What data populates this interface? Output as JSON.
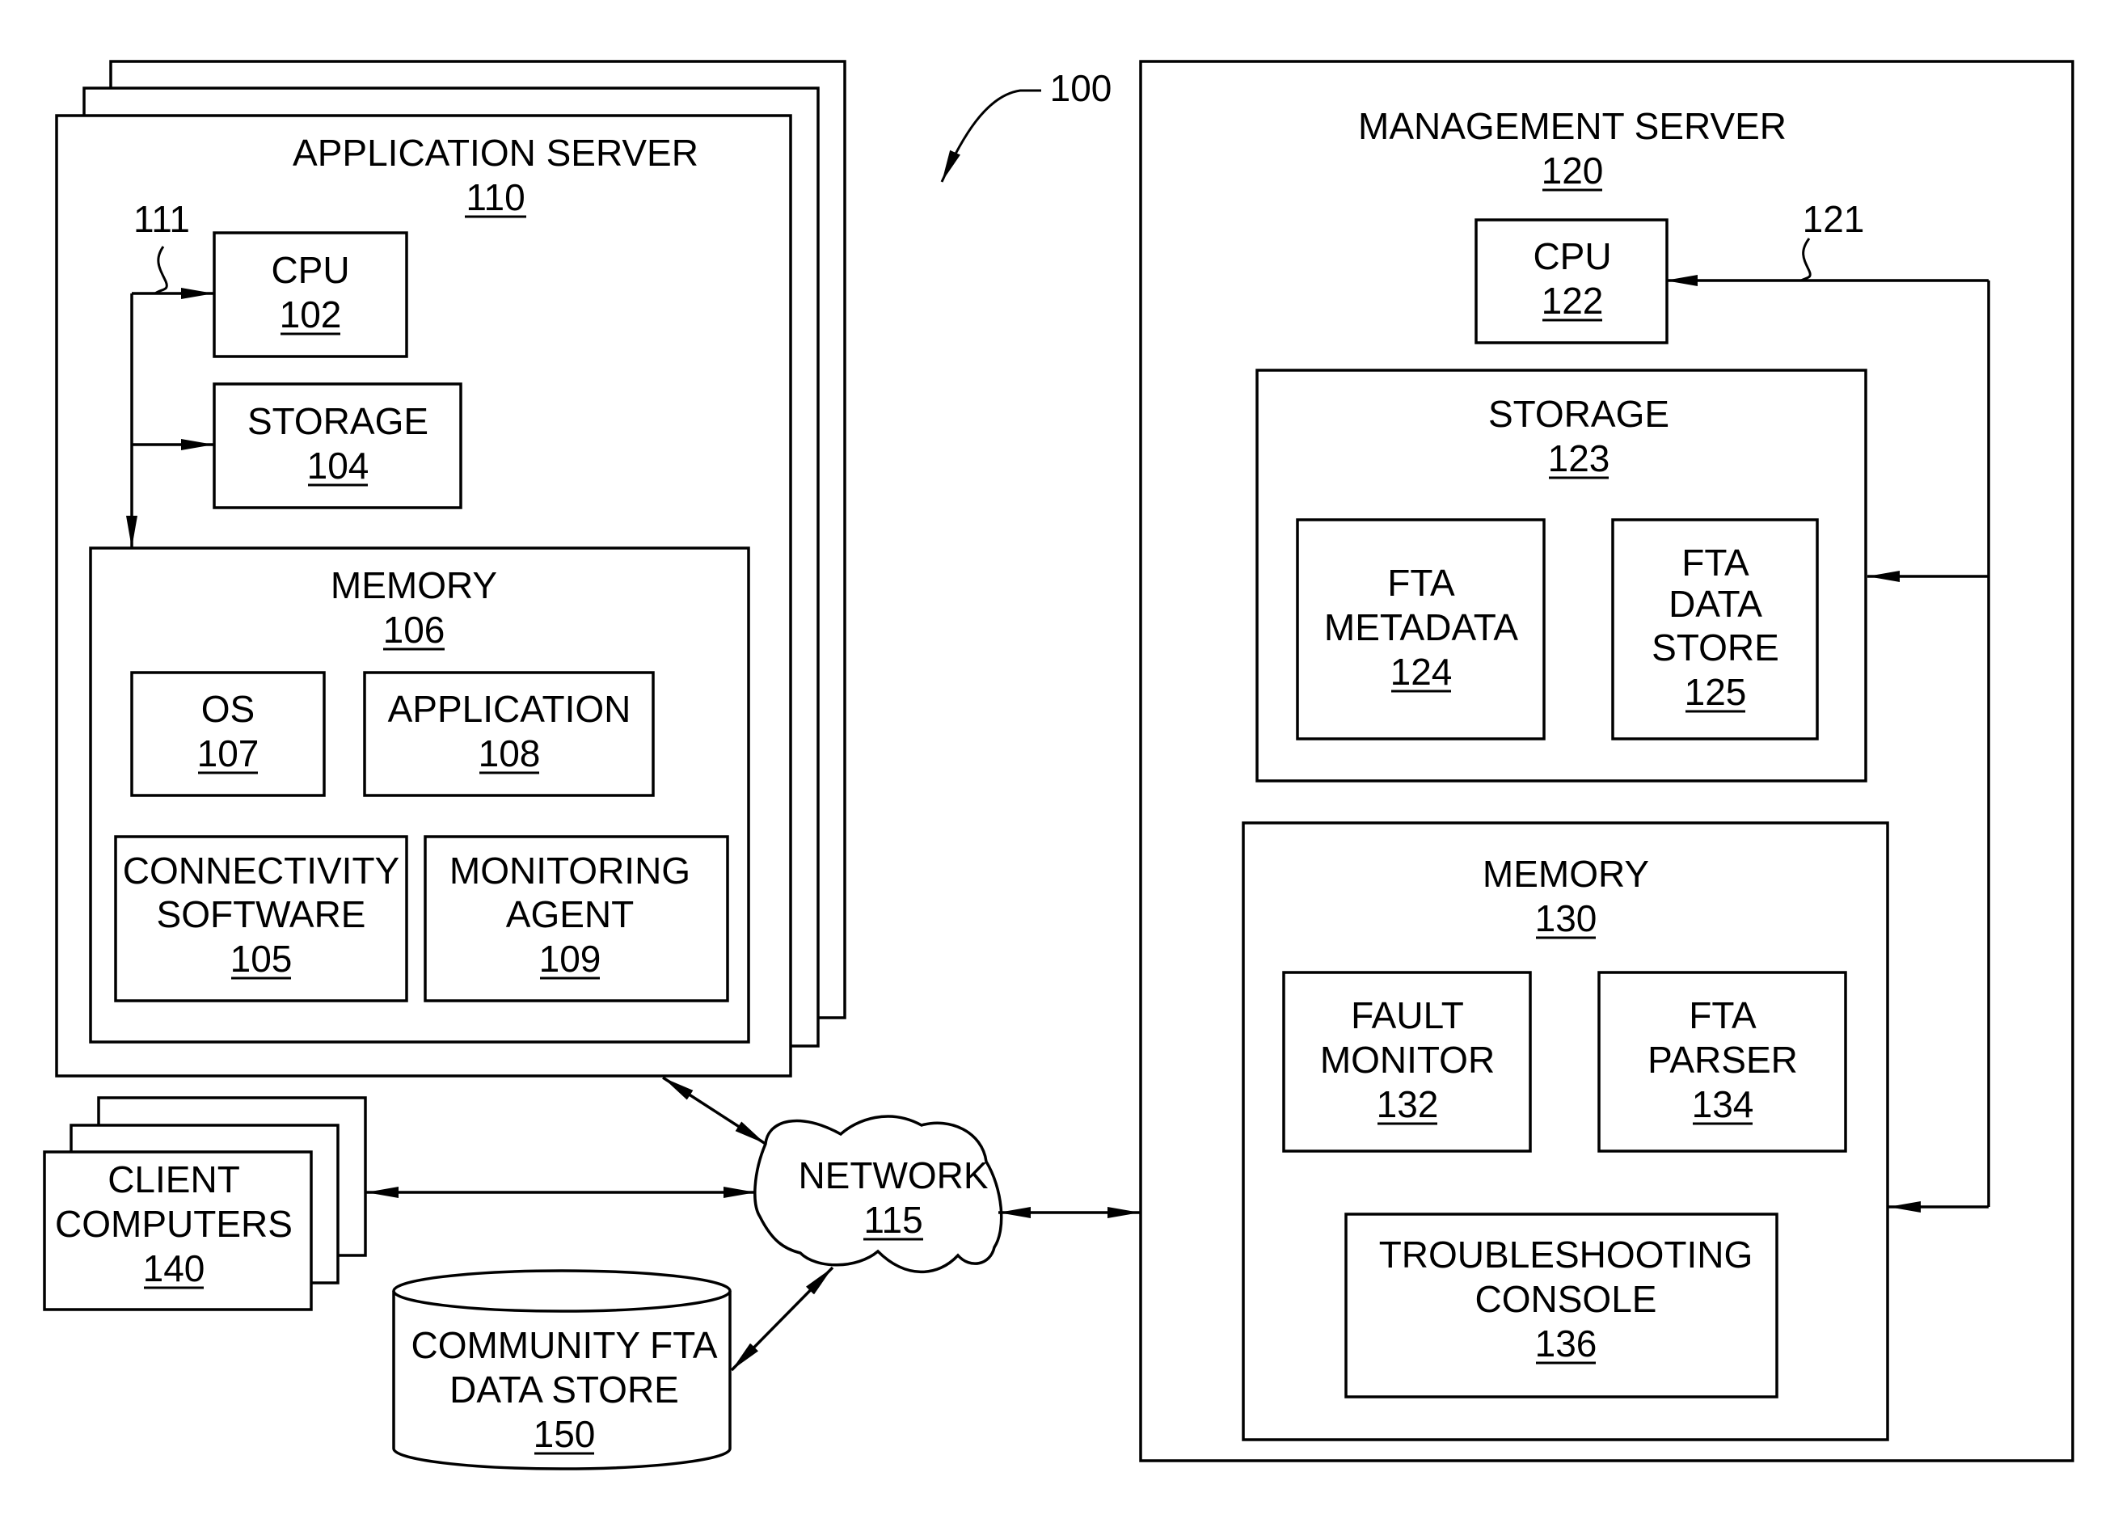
{
  "figure_ref": "100",
  "application_server": {
    "title": "APPLICATION SERVER",
    "ref": "110",
    "bus_ref": "111",
    "cpu": {
      "label": "CPU",
      "ref": "102"
    },
    "storage": {
      "label": "STORAGE",
      "ref": "104"
    },
    "memory": {
      "label": "MEMORY",
      "ref": "106",
      "os": {
        "label": "OS",
        "ref": "107"
      },
      "application": {
        "label": "APPLICATION",
        "ref": "108"
      },
      "connectivity": {
        "line1": "CONNECTIVITY",
        "line2": "SOFTWARE",
        "ref": "105"
      },
      "monitoring": {
        "line1": "MONITORING",
        "line2": "AGENT",
        "ref": "109"
      }
    }
  },
  "client_computers": {
    "line1": "CLIENT",
    "line2": "COMPUTERS",
    "ref": "140"
  },
  "community_store": {
    "line1": "COMMUNITY FTA",
    "line2": "DATA STORE",
    "ref": "150"
  },
  "network": {
    "label": "NETWORK",
    "ref": "115"
  },
  "management_server": {
    "title": "MANAGEMENT SERVER",
    "ref": "120",
    "bus_ref": "121",
    "cpu": {
      "label": "CPU",
      "ref": "122"
    },
    "storage": {
      "label": "STORAGE",
      "ref": "123",
      "metadata": {
        "line1": "FTA",
        "line2": "METADATA",
        "ref": "124"
      },
      "datastore": {
        "line1": "FTA",
        "line2": "DATA",
        "line3": "STORE",
        "ref": "125"
      }
    },
    "memory": {
      "label": "MEMORY",
      "ref": "130",
      "fault_monitor": {
        "line1": "FAULT",
        "line2": "MONITOR",
        "ref": "132"
      },
      "parser": {
        "line1": "FTA",
        "line2": "PARSER",
        "ref": "134"
      },
      "console": {
        "line1": "TROUBLESHOOTING",
        "line2": "CONSOLE",
        "ref": "136"
      }
    }
  }
}
